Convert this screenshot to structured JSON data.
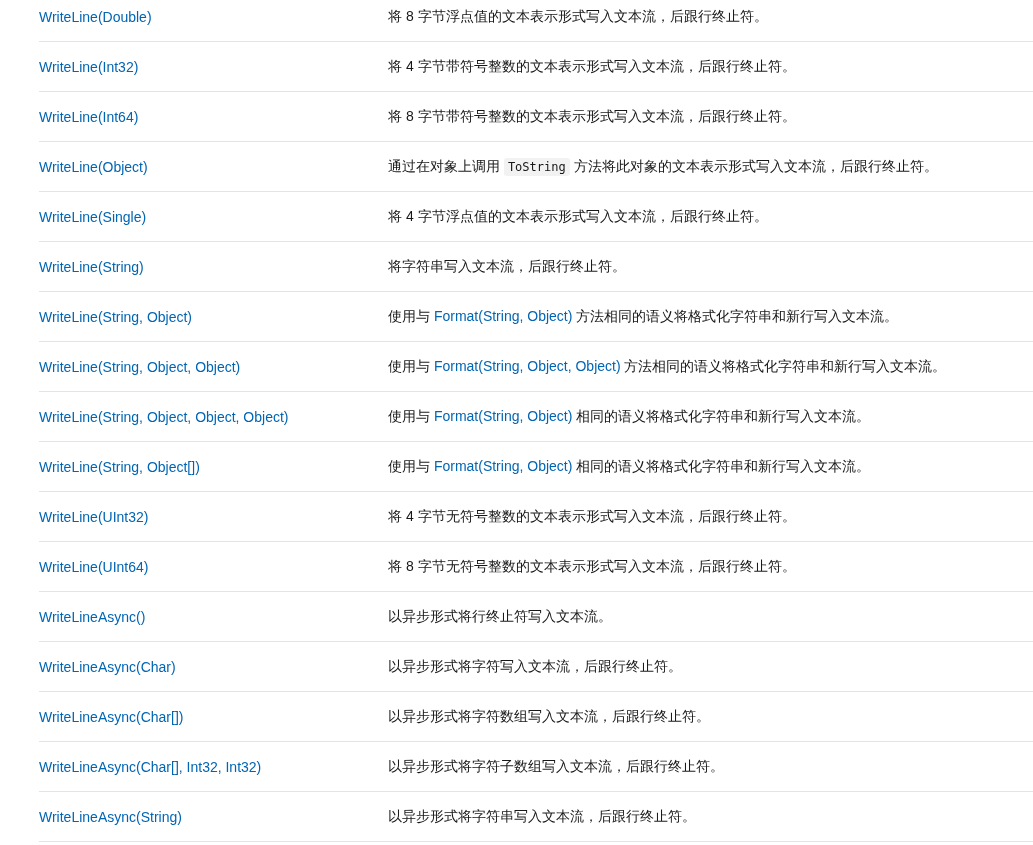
{
  "rows": [
    {
      "method": "WriteLine(Double)",
      "description": [
        {
          "kind": "text",
          "text": "将 8 字节浮点值的文本表示形式写入文本流，后跟行终止符。"
        }
      ]
    },
    {
      "method": "WriteLine(Int32)",
      "description": [
        {
          "kind": "text",
          "text": "将 4 字节带符号整数的文本表示形式写入文本流，后跟行终止符。"
        }
      ]
    },
    {
      "method": "WriteLine(Int64)",
      "description": [
        {
          "kind": "text",
          "text": "将 8 字节带符号整数的文本表示形式写入文本流，后跟行终止符。"
        }
      ]
    },
    {
      "method": "WriteLine(Object)",
      "description": [
        {
          "kind": "text",
          "text": "通过在对象上调用 "
        },
        {
          "kind": "code",
          "text": "ToString"
        },
        {
          "kind": "text",
          "text": " 方法将此对象的文本表示形式写入文本流，后跟行终止符。"
        }
      ]
    },
    {
      "method": "WriteLine(Single)",
      "description": [
        {
          "kind": "text",
          "text": "将 4 字节浮点值的文本表示形式写入文本流，后跟行终止符。"
        }
      ]
    },
    {
      "method": "WriteLine(String)",
      "description": [
        {
          "kind": "text",
          "text": "将字符串写入文本流，后跟行终止符。"
        }
      ]
    },
    {
      "method": "WriteLine(String, Object)",
      "description": [
        {
          "kind": "text",
          "text": "使用与 "
        },
        {
          "kind": "link",
          "text": "Format(String, Object)"
        },
        {
          "kind": "text",
          "text": " 方法相同的语义将格式化字符串和新行写入文本流。"
        }
      ]
    },
    {
      "method": "WriteLine(String, Object, Object)",
      "description": [
        {
          "kind": "text",
          "text": "使用与 "
        },
        {
          "kind": "link",
          "text": "Format(String, Object, Object)"
        },
        {
          "kind": "text",
          "text": " 方法相同的语义将格式化字符串和新行写入文本流。"
        }
      ]
    },
    {
      "method": "WriteLine(String, Object, Object, Object)",
      "description": [
        {
          "kind": "text",
          "text": "使用与 "
        },
        {
          "kind": "link",
          "text": "Format(String, Object)"
        },
        {
          "kind": "text",
          "text": " 相同的语义将格式化字符串和新行写入文本流。"
        }
      ]
    },
    {
      "method": "WriteLine(String, Object[])",
      "description": [
        {
          "kind": "text",
          "text": "使用与 "
        },
        {
          "kind": "link",
          "text": "Format(String, Object)"
        },
        {
          "kind": "text",
          "text": " 相同的语义将格式化字符串和新行写入文本流。"
        }
      ]
    },
    {
      "method": "WriteLine(UInt32)",
      "description": [
        {
          "kind": "text",
          "text": "将 4 字节无符号整数的文本表示形式写入文本流，后跟行终止符。"
        }
      ]
    },
    {
      "method": "WriteLine(UInt64)",
      "description": [
        {
          "kind": "text",
          "text": "将 8 字节无符号整数的文本表示形式写入文本流，后跟行终止符。"
        }
      ]
    },
    {
      "method": "WriteLineAsync()",
      "description": [
        {
          "kind": "text",
          "text": "以异步形式将行终止符写入文本流。"
        }
      ]
    },
    {
      "method": "WriteLineAsync(Char)",
      "description": [
        {
          "kind": "text",
          "text": "以异步形式将字符写入文本流，后跟行终止符。"
        }
      ]
    },
    {
      "method": "WriteLineAsync(Char[])",
      "description": [
        {
          "kind": "text",
          "text": "以异步形式将字符数组写入文本流，后跟行终止符。"
        }
      ]
    },
    {
      "method": "WriteLineAsync(Char[], Int32, Int32)",
      "description": [
        {
          "kind": "text",
          "text": "以异步形式将字符子数组写入文本流，后跟行终止符。"
        }
      ]
    },
    {
      "method": "WriteLineAsync(String)",
      "description": [
        {
          "kind": "text",
          "text": "以异步形式将字符串写入文本流，后跟行终止符。"
        }
      ]
    }
  ]
}
